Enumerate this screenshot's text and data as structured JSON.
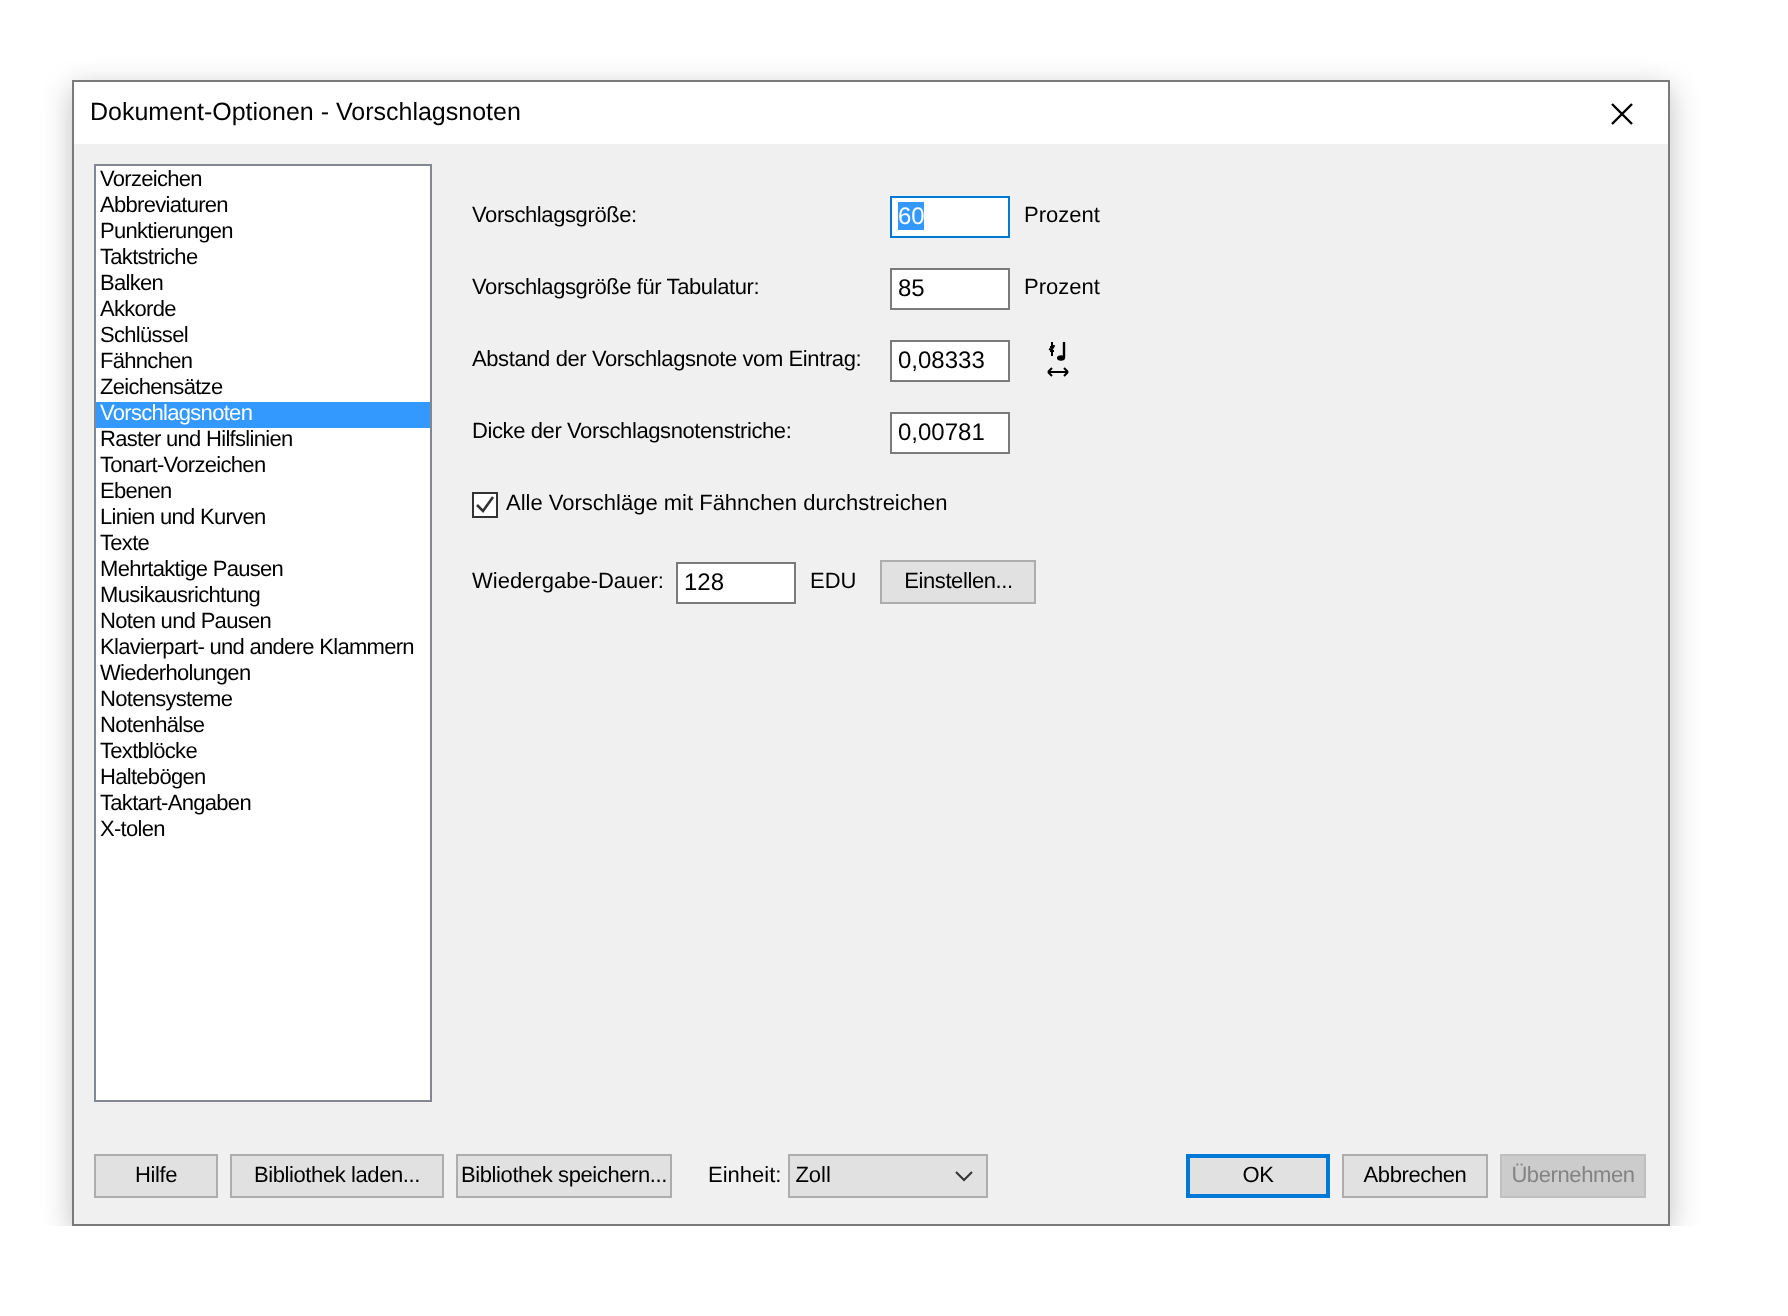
{
  "window": {
    "title": "Dokument-Optionen - Vorschlagsnoten"
  },
  "categories": [
    {
      "label": "Vorzeichen",
      "selected": false
    },
    {
      "label": "Abbreviaturen",
      "selected": false
    },
    {
      "label": "Punktierungen",
      "selected": false
    },
    {
      "label": "Taktstriche",
      "selected": false
    },
    {
      "label": "Balken",
      "selected": false
    },
    {
      "label": "Akkorde",
      "selected": false
    },
    {
      "label": "Schlüssel",
      "selected": false
    },
    {
      "label": "Fähnchen",
      "selected": false
    },
    {
      "label": "Zeichensätze",
      "selected": false
    },
    {
      "label": "Vorschlagsnoten",
      "selected": true
    },
    {
      "label": "Raster und Hilfslinien",
      "selected": false
    },
    {
      "label": "Tonart-Vorzeichen",
      "selected": false
    },
    {
      "label": "Ebenen",
      "selected": false
    },
    {
      "label": "Linien und Kurven",
      "selected": false
    },
    {
      "label": "Texte",
      "selected": false
    },
    {
      "label": "Mehrtaktige Pausen",
      "selected": false
    },
    {
      "label": "Musikausrichtung",
      "selected": false
    },
    {
      "label": "Noten und Pausen",
      "selected": false
    },
    {
      "label": "Klavierpart- und andere Klammern",
      "selected": false
    },
    {
      "label": "Wiederholungen",
      "selected": false
    },
    {
      "label": "Notensysteme",
      "selected": false
    },
    {
      "label": "Notenhälse",
      "selected": false
    },
    {
      "label": "Textblöcke",
      "selected": false
    },
    {
      "label": "Haltebögen",
      "selected": false
    },
    {
      "label": "Taktart-Angaben",
      "selected": false
    },
    {
      "label": "X-tolen",
      "selected": false
    }
  ],
  "fields": [
    {
      "kind": "unit",
      "label": "Vorschlagsgröße:",
      "value": "60",
      "unit": "Prozent",
      "selected": true
    },
    {
      "kind": "unit",
      "label": "Vorschlagsgröße für Tabulatur:",
      "value": "85",
      "unit": "Prozent",
      "selected": false
    },
    {
      "kind": "icon",
      "label": "Abstand der Vorschlagsnote vom Eintrag:",
      "value": "0,08333",
      "selected": false
    },
    {
      "kind": "plain",
      "label": "Dicke der Vorschlagsnotenstriche:",
      "value": "0,00781",
      "selected": false
    }
  ],
  "checkbox": {
    "label": "Alle Vorschläge mit Fähnchen durchstreichen",
    "checked": true
  },
  "playback": {
    "label": "Wiedergabe-Dauer:",
    "value": "128",
    "unit": "EDU",
    "button": "Einstellen..."
  },
  "footer": {
    "left_buttons": [
      "Hilfe",
      "Bibliothek laden...",
      "Bibliothek speichern..."
    ],
    "unit_label": "Einheit:",
    "unit_value": "Zoll",
    "right_buttons": [
      {
        "label": "OK",
        "default": true,
        "disabled": false
      },
      {
        "label": "Abbrechen",
        "default": false,
        "disabled": false
      },
      {
        "label": "Übernehmen",
        "default": false,
        "disabled": true
      }
    ]
  }
}
